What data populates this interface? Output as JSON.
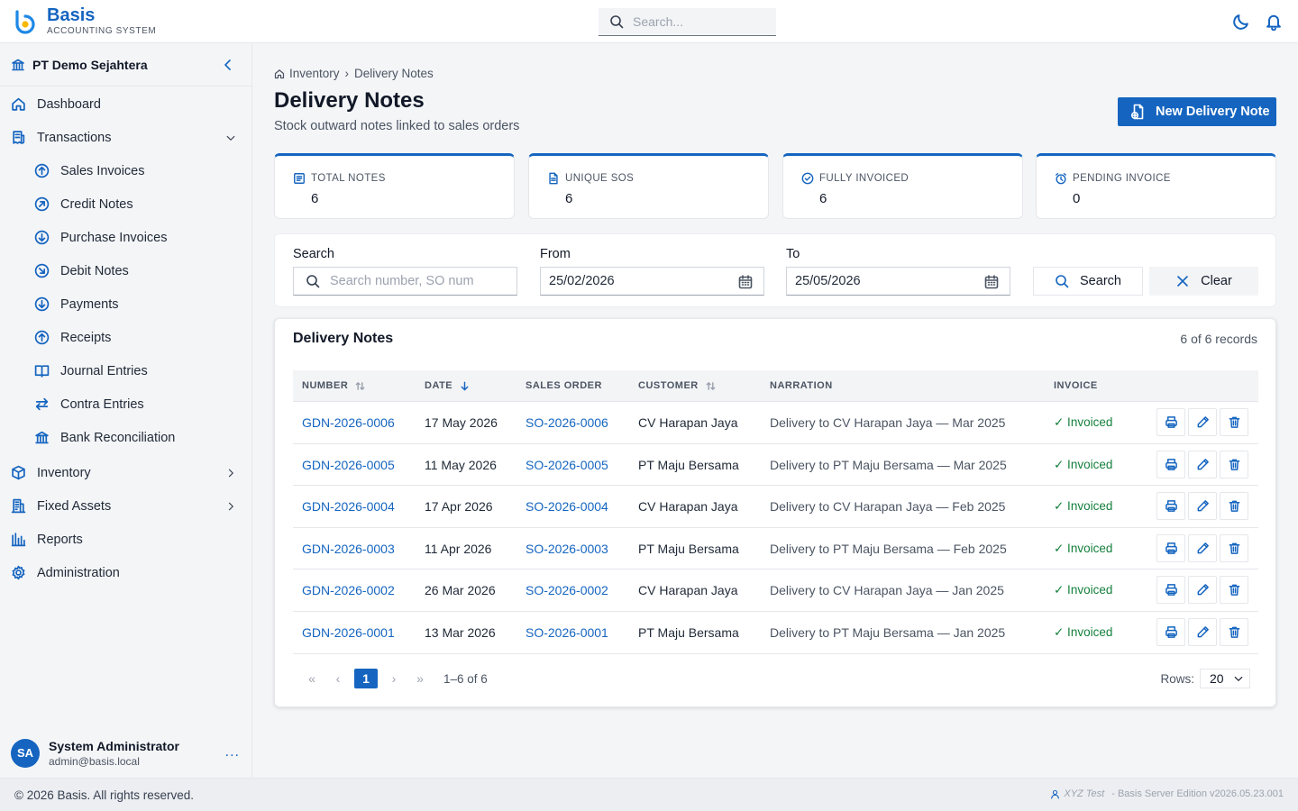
{
  "app": {
    "name": "Basis",
    "subtitle": "ACCOUNTING SYSTEM"
  },
  "header": {
    "search_placeholder": "Search...",
    "theme_icon": "moon-icon",
    "notif_icon": "bell-icon"
  },
  "sidebar": {
    "company": "PT Demo Sejahtera",
    "items": [
      {
        "label": "Dashboard",
        "icon": "home-icon"
      },
      {
        "label": "Transactions",
        "icon": "receipt-icon"
      },
      {
        "label": "Sales Invoices",
        "icon": "arrow-up-circle-icon"
      },
      {
        "label": "Credit Notes",
        "icon": "arrow-up-right-circle-icon"
      },
      {
        "label": "Purchase Invoices",
        "icon": "arrow-down-circle-icon"
      },
      {
        "label": "Debit Notes",
        "icon": "arrow-down-right-circle-icon"
      },
      {
        "label": "Payments",
        "icon": "arrow-down-circle-icon"
      },
      {
        "label": "Receipts",
        "icon": "arrow-up-circle-icon"
      },
      {
        "label": "Journal Entries",
        "icon": "book-icon"
      },
      {
        "label": "Contra Entries",
        "icon": "swap-icon"
      },
      {
        "label": "Bank Reconciliation",
        "icon": "bank-icon"
      },
      {
        "label": "Inventory",
        "icon": "box-icon"
      },
      {
        "label": "Fixed Assets",
        "icon": "building-icon"
      },
      {
        "label": "Reports",
        "icon": "bar-chart-icon"
      },
      {
        "label": "Administration",
        "icon": "gear-icon"
      }
    ],
    "user": {
      "initials": "SA",
      "name": "System Administrator",
      "email": "admin@basis.local",
      "more": "..."
    }
  },
  "breadcrumb": {
    "section": "Inventory",
    "page": "Delivery Notes"
  },
  "page": {
    "title": "Delivery Notes",
    "subtitle": "Stock outward notes linked to sales orders",
    "new_button": "New Delivery Note"
  },
  "stats": [
    {
      "label": "TOTAL NOTES",
      "value": "6",
      "icon": "receipt-icon"
    },
    {
      "label": "UNIQUE SOS",
      "value": "6",
      "icon": "document-icon"
    },
    {
      "label": "FULLY INVOICED",
      "value": "6",
      "icon": "check-circle-icon"
    },
    {
      "label": "PENDING INVOICE",
      "value": "0",
      "icon": "alarm-icon"
    }
  ],
  "filters": {
    "search_label": "Search",
    "search_placeholder": "Search number, SO num",
    "from_label": "From",
    "from_value": "25/02/2026",
    "to_label": "To",
    "to_value": "25/05/2026",
    "search_button": "Search",
    "clear_button": "Clear"
  },
  "table": {
    "title": "Delivery Notes",
    "count": "6 of 6 records",
    "columns": [
      "NUMBER",
      "DATE",
      "SALES ORDER",
      "CUSTOMER",
      "NARRATION",
      "INVOICE"
    ],
    "rows": [
      {
        "number": "GDN-2026-0006",
        "date": "17 May 2026",
        "so": "SO-2026-0006",
        "customer": "CV Harapan Jaya",
        "narration": "Delivery to CV Harapan Jaya — Mar 2025",
        "invoice": "✓ Invoiced"
      },
      {
        "number": "GDN-2026-0005",
        "date": "11 May 2026",
        "so": "SO-2026-0005",
        "customer": "PT Maju Bersama",
        "narration": "Delivery to PT Maju Bersama — Mar 2025",
        "invoice": "✓ Invoiced"
      },
      {
        "number": "GDN-2026-0004",
        "date": "17 Apr 2026",
        "so": "SO-2026-0004",
        "customer": "CV Harapan Jaya",
        "narration": "Delivery to CV Harapan Jaya — Feb 2025",
        "invoice": "✓ Invoiced"
      },
      {
        "number": "GDN-2026-0003",
        "date": "11 Apr 2026",
        "so": "SO-2026-0003",
        "customer": "PT Maju Bersama",
        "narration": "Delivery to PT Maju Bersama — Feb 2025",
        "invoice": "✓ Invoiced"
      },
      {
        "number": "GDN-2026-0002",
        "date": "26 Mar 2026",
        "so": "SO-2026-0002",
        "customer": "CV Harapan Jaya",
        "narration": "Delivery to CV Harapan Jaya — Jan 2025",
        "invoice": "✓ Invoiced"
      },
      {
        "number": "GDN-2026-0001",
        "date": "13 Mar 2026",
        "so": "SO-2026-0001",
        "customer": "PT Maju Bersama",
        "narration": "Delivery to PT Maju Bersama — Jan 2025",
        "invoice": "✓ Invoiced"
      }
    ]
  },
  "pagination": {
    "current": "1",
    "range": "1–6 of 6",
    "rows_label": "Rows:",
    "rows_value": "20",
    "first": "«",
    "prev": "‹",
    "next": "›",
    "last": "»"
  },
  "footer": {
    "copyright": "© 2026 Basis. All rights reserved.",
    "environment": "XYZ Test",
    "version": "- Basis Server Edition v2026.05.23.001"
  },
  "colors": {
    "accent": "#1565c0",
    "success": "#15803d"
  }
}
